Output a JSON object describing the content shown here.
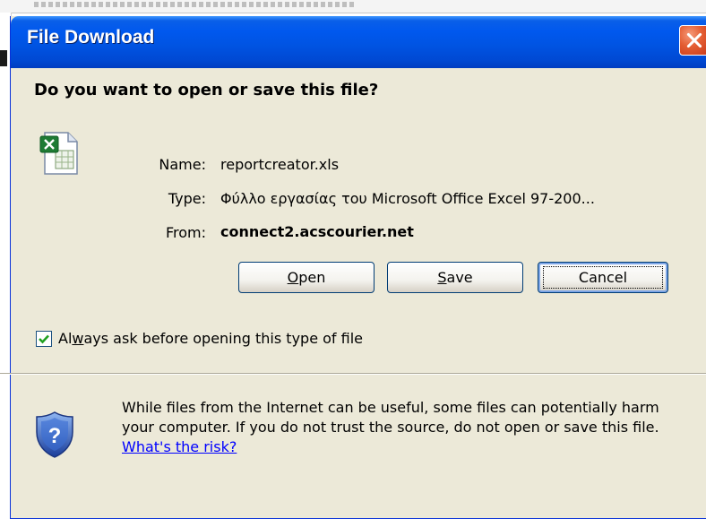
{
  "window": {
    "title": "File Download",
    "close_icon": "close-icon"
  },
  "dialog": {
    "question": "Do you want to open or save this file?",
    "file_icon": "excel-file-icon",
    "name_label": "Name:",
    "name_value": "reportcreator.xls",
    "type_label": "Type:",
    "type_value": "Φύλλο εργασίας του Microsoft Office Excel 97-200...",
    "from_label": "From:",
    "from_value": "connect2.acscourier.net",
    "buttons": {
      "open_mnemonic": "O",
      "open_rest": "pen",
      "save_mnemonic": "S",
      "save_rest": "ave",
      "cancel": "Cancel"
    },
    "checkbox": {
      "checked": true,
      "label_a": "Al",
      "label_mnemonic": "w",
      "label_b": "ays ask before opening this type of file"
    },
    "warning": {
      "icon": "shield-question-icon",
      "text": "While files from the Internet can be useful, some files can potentially harm your computer. If you do not trust the source, do not open or save this file.",
      "link": "What's the risk?"
    }
  },
  "colors": {
    "titlebar": "#0054e3",
    "dialog_bg": "#ece9d8",
    "close_button": "#e45d32",
    "link": "#0000ff"
  }
}
